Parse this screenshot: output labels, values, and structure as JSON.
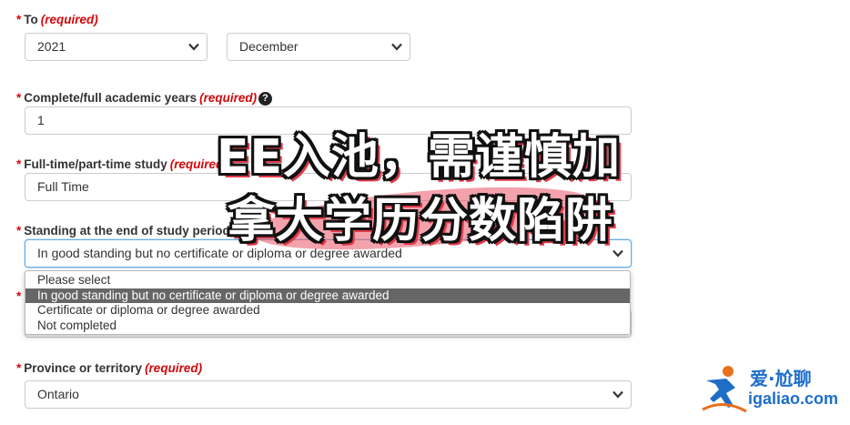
{
  "fields": {
    "to": {
      "label": "To",
      "required": "(required)",
      "asterisk": "*",
      "year": "2021",
      "month": "December"
    },
    "academic_years": {
      "label": "Complete/full academic years",
      "required": "(required)",
      "asterisk": "*",
      "value": "1",
      "help_icon": "question-circle-icon",
      "help_glyph": "?"
    },
    "study_type": {
      "label": "Full-time/part-time study",
      "required": "(required",
      "asterisk": "*",
      "value": "Full Time"
    },
    "standing": {
      "label": "Standing at the end of study period",
      "asterisk": "*",
      "value": "In good standing but no certificate or diploma or degree awarded",
      "options": [
        "Please select",
        "In good standing but no certificate or diploma or degree awarded",
        "Certificate or diploma or degree awarded",
        "Not completed"
      ],
      "selected_index": 1
    },
    "hidden_field": {
      "asterisk": "*"
    },
    "province": {
      "label": "Province or territory",
      "required": "(required)",
      "asterisk": "*",
      "value": "Ontario"
    }
  },
  "overlay": {
    "line1": "EE入池，需谨慎加",
    "line2": "拿大学历分数陷阱"
  },
  "watermark": {
    "top": "爱·尬聊",
    "bottom": "igaliao.com"
  },
  "colors": {
    "required": "#d3080c",
    "selected_option_bg": "#666666",
    "focus_border": "#66afe9",
    "watermark_blue": "#1e6ec8"
  }
}
